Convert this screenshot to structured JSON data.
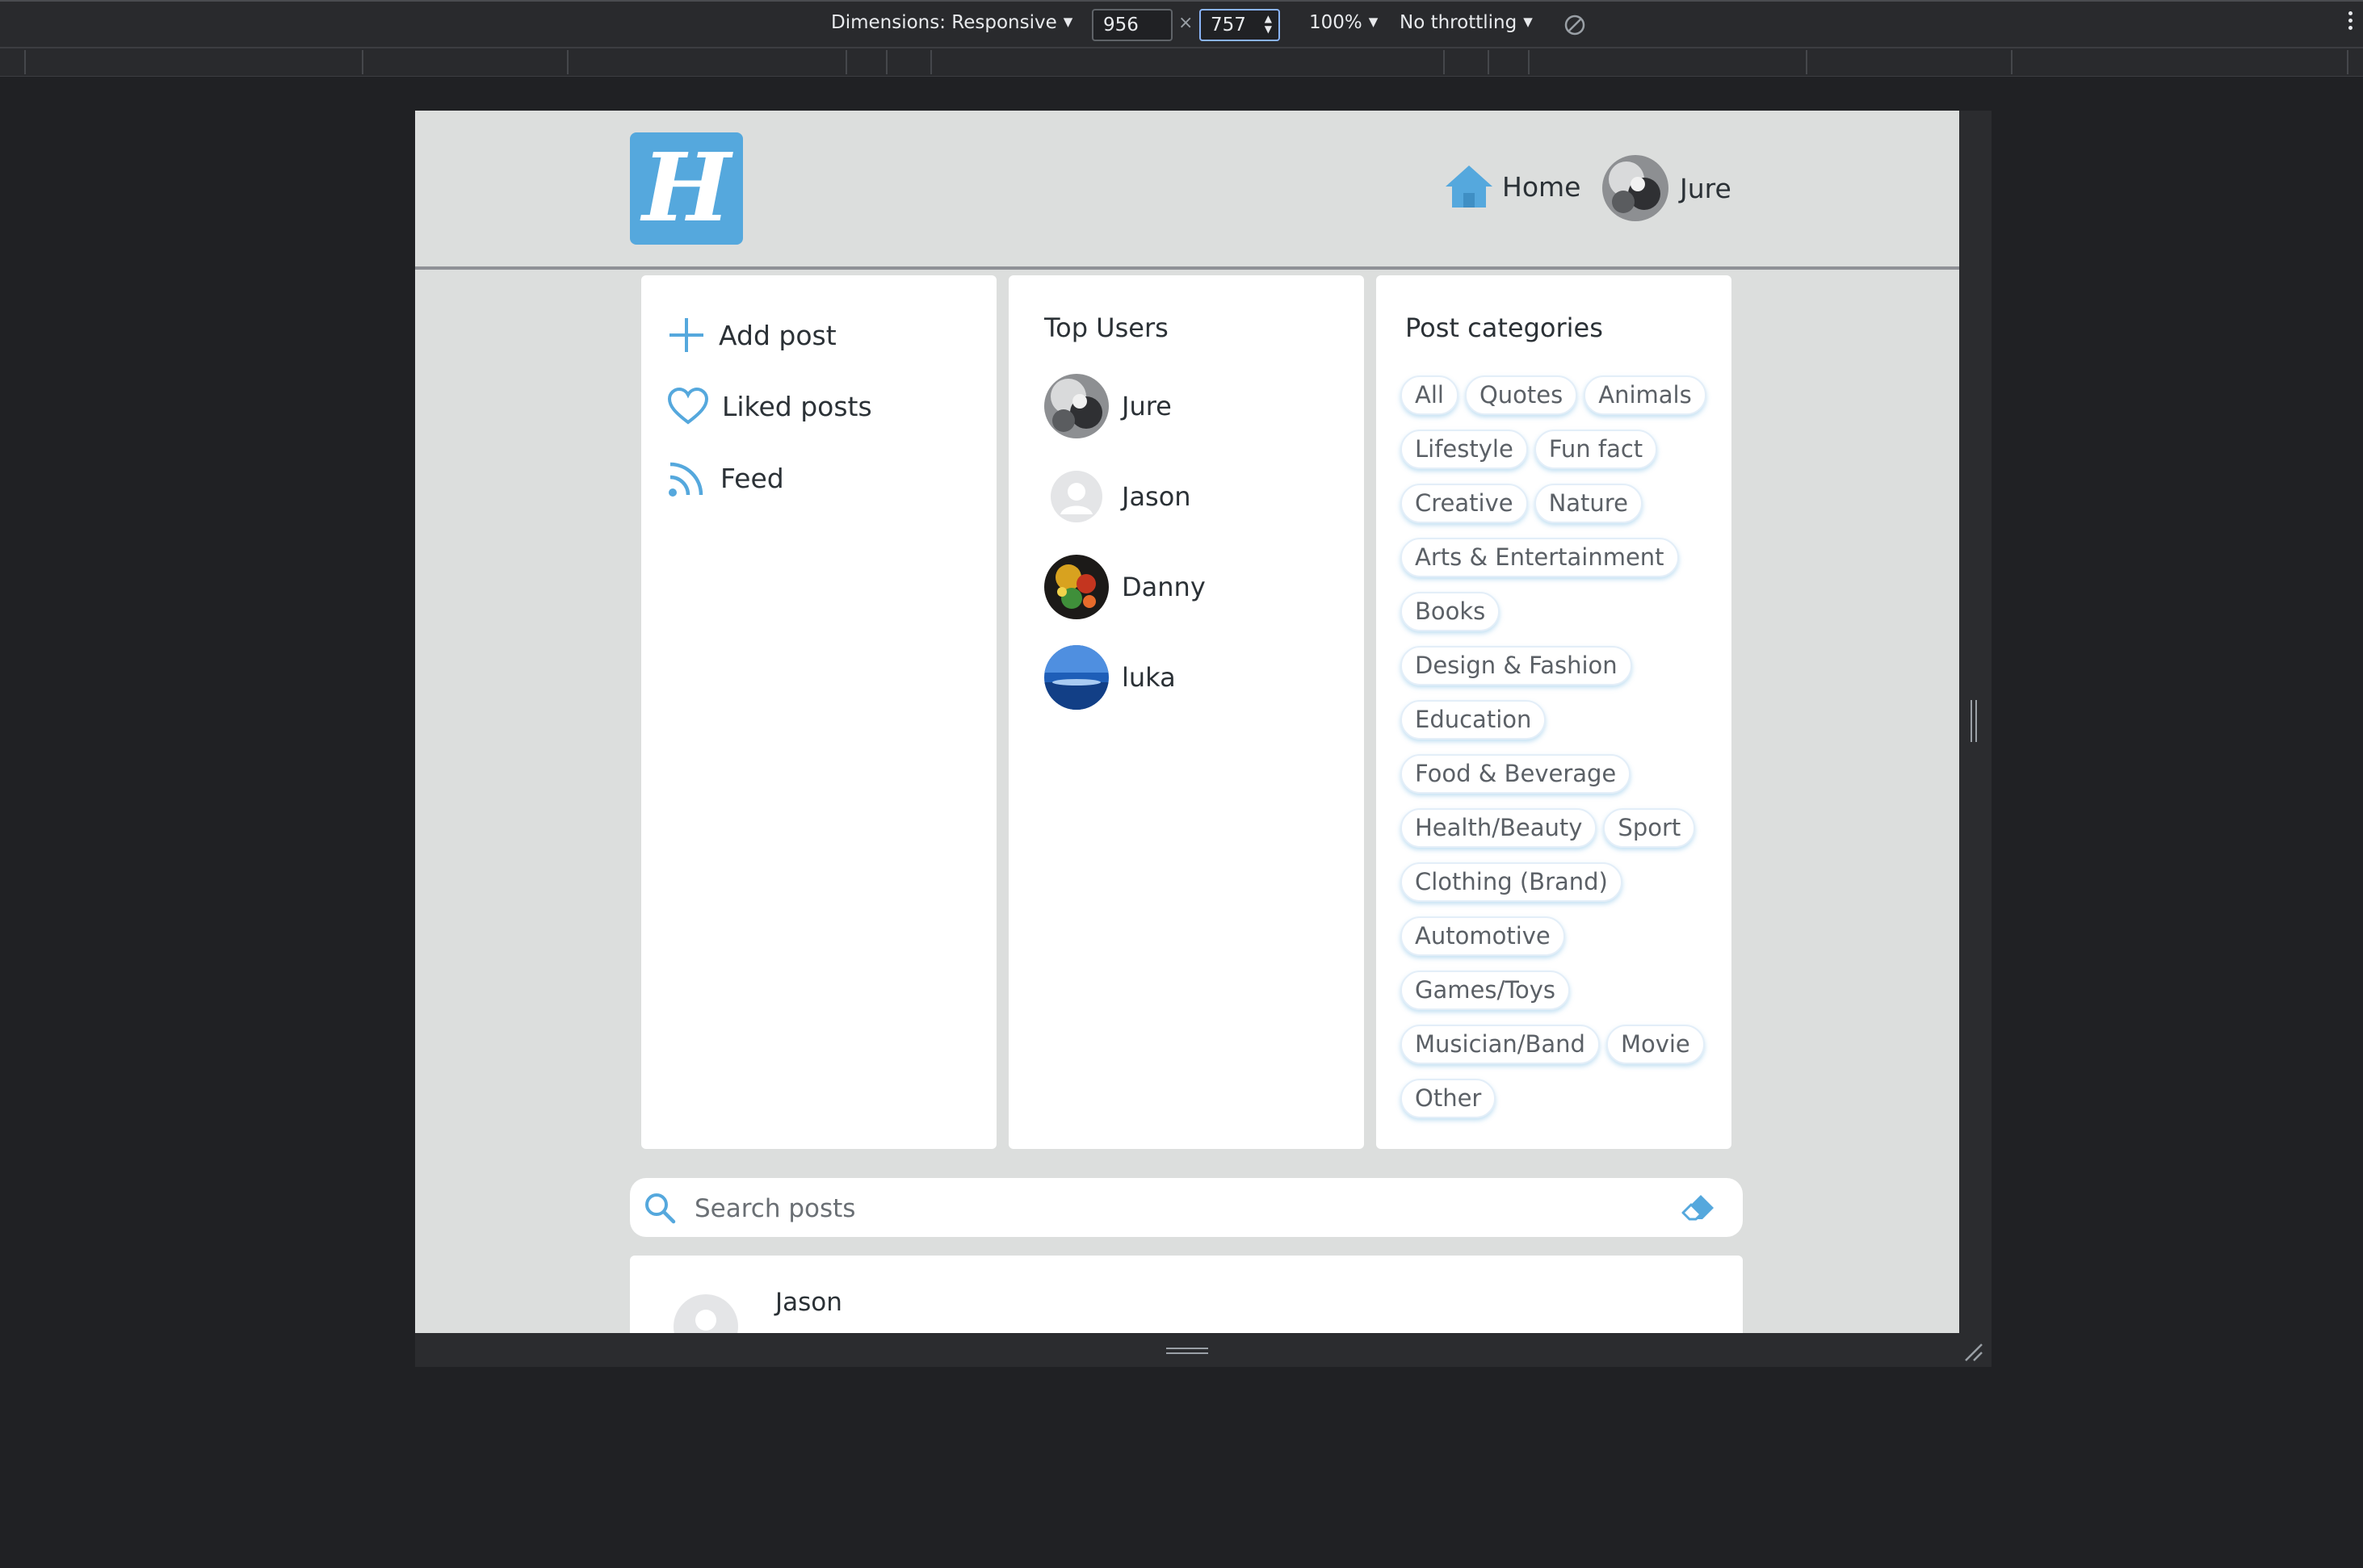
{
  "devtools": {
    "dimensions_label": "Dimensions: Responsive",
    "width_value": "956",
    "height_value": "757",
    "times_sign": "×",
    "zoom_label": "100%",
    "throttle_label": "No throttling"
  },
  "header": {
    "logo_letter": "H",
    "home_label": "Home",
    "user_name": "Jure"
  },
  "sidebar": {
    "items": [
      {
        "label": "Add post",
        "icon": "plus-icon"
      },
      {
        "label": "Liked posts",
        "icon": "heart-icon"
      },
      {
        "label": "Feed",
        "icon": "rss-icon"
      }
    ]
  },
  "top_users": {
    "title": "Top Users",
    "users": [
      {
        "name": "Jure"
      },
      {
        "name": "Jason"
      },
      {
        "name": "Danny"
      },
      {
        "name": "luka"
      }
    ]
  },
  "categories": {
    "title": "Post categories",
    "rows": [
      [
        "All",
        "Quotes",
        "Animals"
      ],
      [
        "Lifestyle",
        "Fun fact"
      ],
      [
        "Creative",
        "Nature"
      ],
      [
        "Arts & Entertainment"
      ],
      [
        "Books"
      ],
      [
        "Design & Fashion"
      ],
      [
        "Education"
      ],
      [
        "Food & Beverage"
      ],
      [
        "Health/Beauty",
        "Sport"
      ],
      [
        "Clothing (Brand)"
      ],
      [
        "Automotive"
      ],
      [
        "Games/Toys"
      ],
      [
        "Musician/Band",
        "Movie"
      ],
      [
        "Other"
      ]
    ]
  },
  "search": {
    "placeholder": "Search posts"
  },
  "post": {
    "author": "Jason"
  },
  "colors": {
    "accent": "#55a8dd",
    "page_bg": "#dcdedd",
    "text": "#2b3136"
  }
}
